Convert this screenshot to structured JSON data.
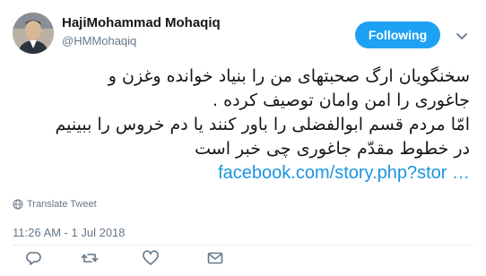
{
  "user": {
    "display_name": "HajiMohammad Mohaqiq",
    "handle": "@HMMohaqiq"
  },
  "follow_button_label": "Following",
  "tweet": {
    "lines": [
      "سخنگویان ارگ صحبتهای من را بنیاد خوانده وغزن و",
      "جاغوری را امن وامان توصیف کرده .",
      "امّا مردم قسم ابوالفضلی را باور کنند یا دم خروس را  ببینیم",
      "در خطوط مقدّم جاغوری چی خبر است"
    ],
    "link_text": "facebook.com/story.php?stor …"
  },
  "translate_label": "Translate Tweet",
  "timestamp": "11:26 AM - 1 Jul 2018",
  "icons": [
    "avatar",
    "chevron-down-icon",
    "globe-icon",
    "reply-icon",
    "retweet-icon",
    "like-icon",
    "message-icon"
  ],
  "colors": {
    "accent": "#1da1f2",
    "link": "#1b95e0",
    "secondary_text": "#657786"
  }
}
